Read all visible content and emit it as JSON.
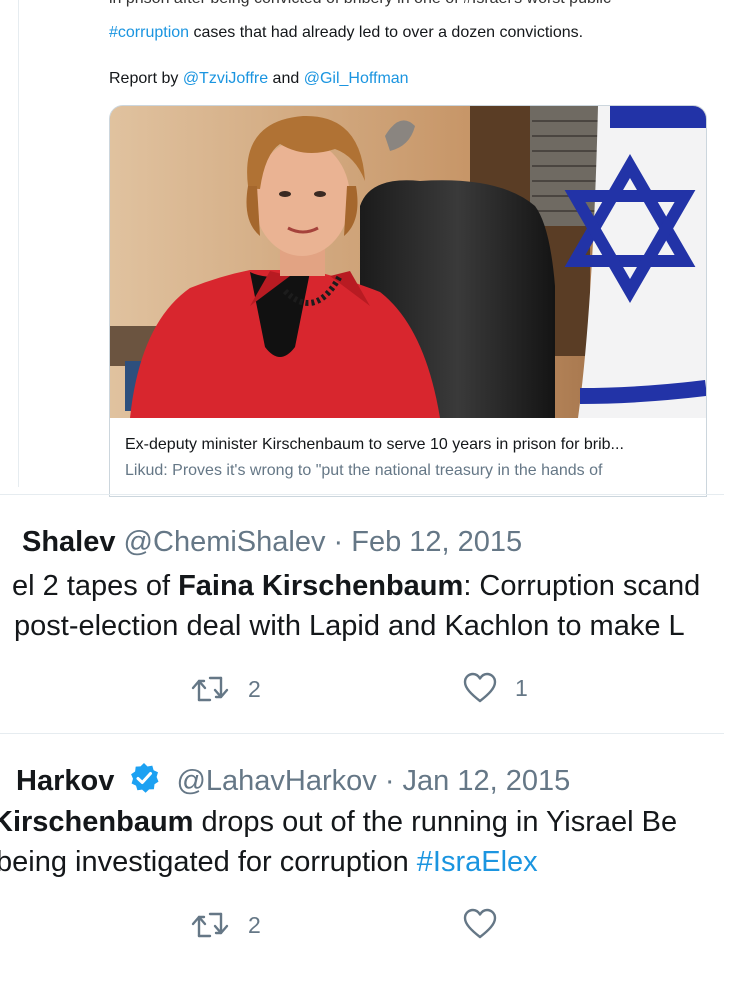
{
  "tweet1": {
    "cut_line": "in prison after being convicted of bribery in one of #Israel's worst public",
    "line1_hashtag": "#corruption",
    "line1_rest": " cases that had already led to over a dozen convictions.",
    "report_prefix": "Report by ",
    "author1": "@TzviJoffre",
    "and_text": " and ",
    "author2": "@Gil_Hoffman",
    "card_title": "Ex-deputy minister Kirschenbaum to serve 10 years in prison for brib...",
    "card_desc": "Likud: Proves it's wrong to \"put the national treasury in the hands of"
  },
  "tweet2": {
    "name": "Shalev",
    "handle_date": " @ChemiShalev · Feb 12, 2015",
    "line1_a": "el 2 tapes of ",
    "line1_bold": "Faina Kirschenbaum",
    "line1_b": ": Corruption scand",
    "line2": "post-election deal with Lapid and Kachlon to make L",
    "retweets": "2",
    "likes": "1"
  },
  "tweet3": {
    "name": "Harkov",
    "handle_date": "@LahavHarkov · Jan 12, 2015",
    "line1_bold": "Kirschenbaum",
    "line1_rest": " drops out of the running in Yisrael Be",
    "line2_a": "being investigated for corruption ",
    "line2_hashtag": "#IsraElex",
    "retweets": "2"
  },
  "colors": {
    "link": "#1b95e0",
    "muted": "#657786",
    "text": "#14171a",
    "verified": "#1da1f2"
  },
  "icons": [
    "retweet-icon",
    "heart-icon",
    "verified-badge-icon"
  ]
}
